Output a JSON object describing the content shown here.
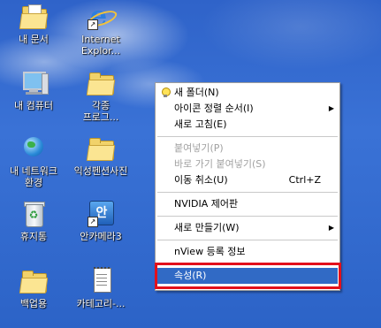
{
  "desktop": {
    "icons": [
      {
        "label": "내 문서",
        "icon": "my-documents-icon"
      },
      {
        "label": "Internet\nExplor...",
        "icon": "internet-explorer-icon"
      },
      {
        "label": "내 컴퓨터",
        "icon": "my-computer-icon"
      },
      {
        "label": "각종\n프로그...",
        "icon": "folder-icon"
      },
      {
        "label": "내 네트워크\n환경",
        "icon": "network-places-icon"
      },
      {
        "label": "익성펜션사진",
        "icon": "folder-icon"
      },
      {
        "label": "휴지통",
        "icon": "recycle-bin-icon"
      },
      {
        "label": "안카메라3",
        "icon": "app-shortcut-icon",
        "glyph_text": "안"
      },
      {
        "label": "백업용",
        "icon": "folder-icon"
      },
      {
        "label": "카테고리-...",
        "icon": "text-file-icon"
      }
    ]
  },
  "context_menu": {
    "items": {
      "new_folder": "새 폴더(N)",
      "arrange_icons": "아이콘 정렬 순서(I)",
      "refresh": "새로 고침(E)",
      "paste": "붙여넣기(P)",
      "paste_shortcut": "바로 가기 붙여넣기(S)",
      "undo_move": "이동 취소(U)",
      "undo_move_shortcut": "Ctrl+Z",
      "nvidia": "NVIDIA 제어판",
      "new": "새로 만들기(W)",
      "nview": "nView 등록 정보",
      "properties": "속성(R)"
    },
    "submenu_arrow": "▶",
    "selected_item": "속성(R)",
    "highlight_color": "#e3101b",
    "selection_color": "#316ac5"
  }
}
